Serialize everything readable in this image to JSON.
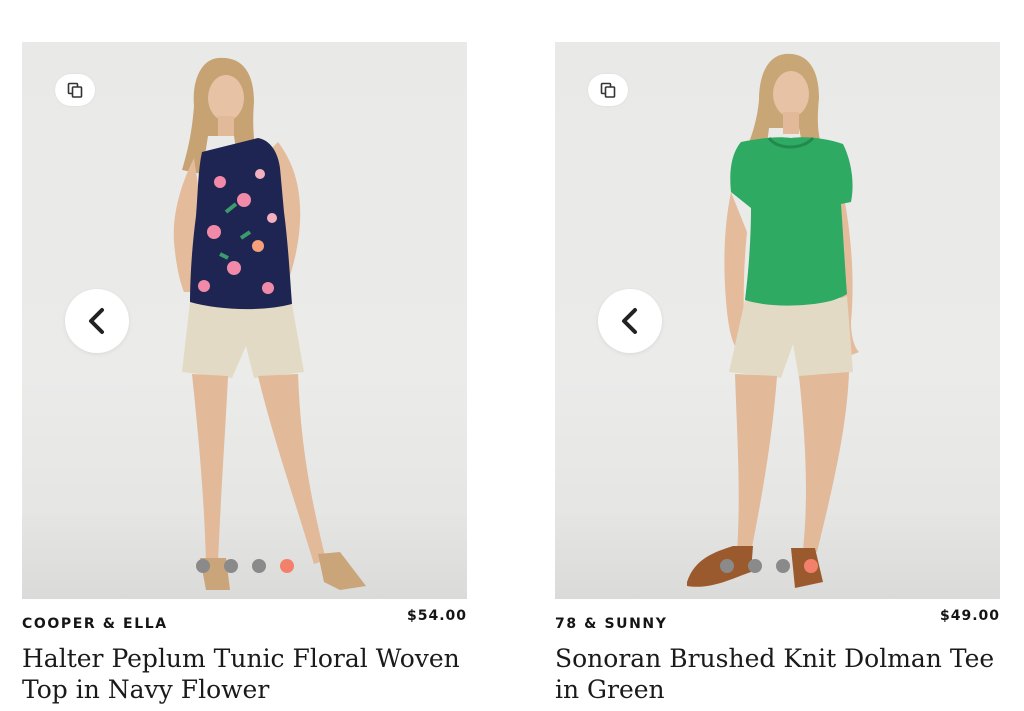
{
  "products": [
    {
      "brand": "COOPER & ELLA",
      "price": "$54.00",
      "title": "Halter Peplum Tunic Floral Woven Top in Navy Flower",
      "image_alt": "Model wearing navy floral halter top with khaki shorts",
      "dots_total": 4,
      "dots_active": 4,
      "colors": {
        "top": "#1f2552",
        "accent_flowers": "#f08aa8",
        "shorts": "#e3dac6",
        "sandals": "#caa57a"
      }
    },
    {
      "brand": "78 & SUNNY",
      "price": "$49.00",
      "title": "Sonoran Brushed Knit Dolman Tee in Green",
      "image_alt": "Model wearing green dolman tee with khaki shorts",
      "dots_total": 4,
      "dots_active": 4,
      "colors": {
        "top": "#2eaa63",
        "shorts": "#e3dac6",
        "sandals": "#9b5a2e"
      }
    }
  ],
  "icons": {
    "copy": "copy-icon",
    "prev": "chevron-left-icon"
  },
  "theme": {
    "dot_inactive": "#8a8a8a",
    "dot_active": "#f3806b",
    "image_bg": "#e9e9e7"
  }
}
